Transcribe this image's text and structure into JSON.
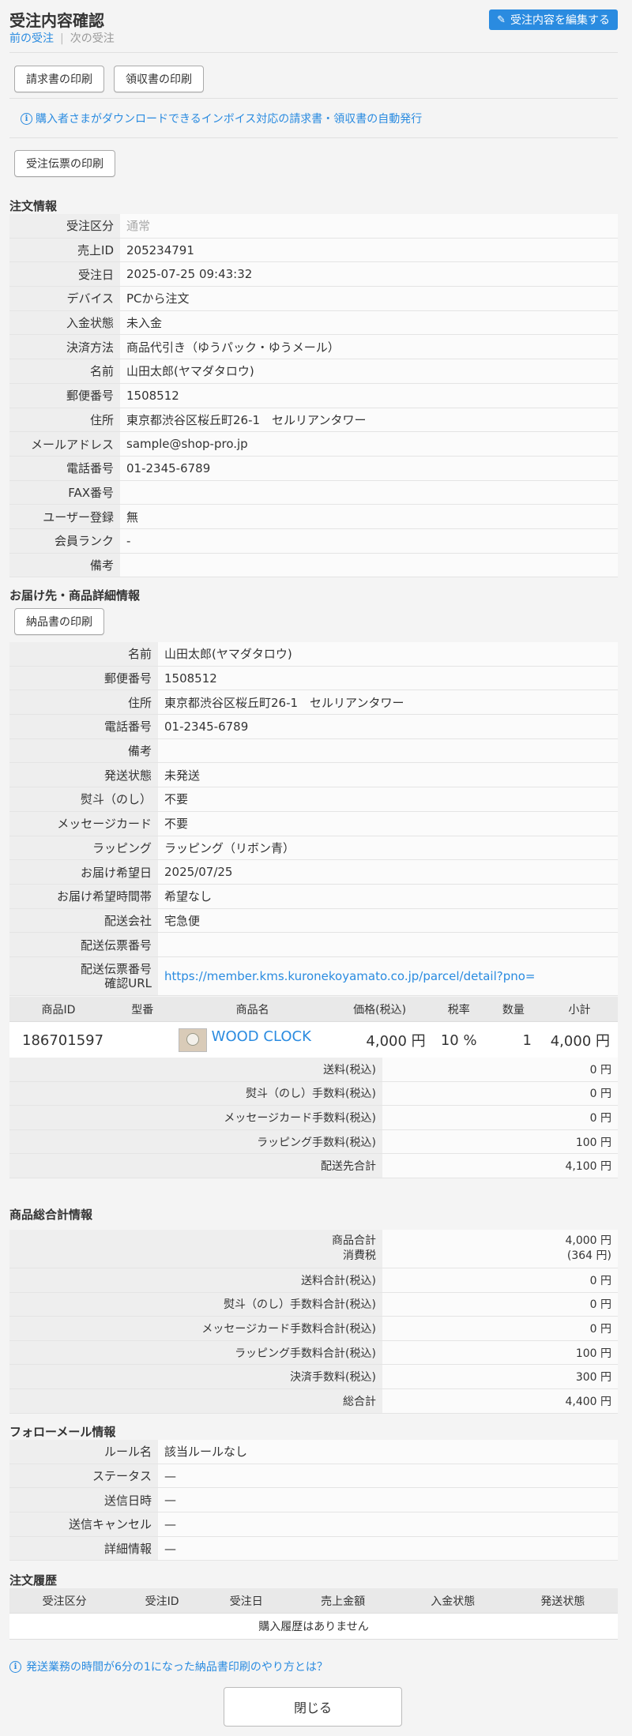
{
  "header": {
    "title": "受注内容確認",
    "edit_label": "受注内容を編集する",
    "prev_label": "前の受注",
    "next_label": "次の受注"
  },
  "print": {
    "invoice_label": "請求書の印刷",
    "receipt_label": "領収書の印刷",
    "invoice_info": "購入者さまがダウンロードできるインボイス対応の請求書・領収書の自動発行",
    "order_slip_label": "受注伝票の印刷",
    "delivery_note_label": "納品書の印刷"
  },
  "order_info": {
    "title": "注文情報",
    "rows": [
      {
        "k": "受注区分",
        "v": "通常"
      },
      {
        "k": "売上ID",
        "v": "205234791"
      },
      {
        "k": "受注日",
        "v": "2025-07-25 09:43:32"
      },
      {
        "k": "デバイス",
        "v": "PCから注文"
      },
      {
        "k": "入金状態",
        "v": "未入金"
      },
      {
        "k": "決済方法",
        "v": "商品代引き（ゆうパック・ゆうメール）"
      },
      {
        "k": "名前",
        "v": "山田太郎(ヤマダタロウ)"
      },
      {
        "k": "郵便番号",
        "v": "1508512"
      },
      {
        "k": "住所",
        "v": "東京都渋谷区桜丘町26-1　セルリアンタワー"
      },
      {
        "k": "メールアドレス",
        "v": "sample@shop-pro.jp"
      },
      {
        "k": "電話番号",
        "v": "01-2345-6789"
      },
      {
        "k": "FAX番号",
        "v": ""
      },
      {
        "k": "ユーザー登録",
        "v": "無"
      },
      {
        "k": "会員ランク",
        "v": "-"
      },
      {
        "k": "備考",
        "v": ""
      }
    ]
  },
  "delivery": {
    "title": "お届け先・商品詳細情報",
    "rows": [
      {
        "k": "名前",
        "v": "山田太郎(ヤマダタロウ)"
      },
      {
        "k": "郵便番号",
        "v": "1508512"
      },
      {
        "k": "住所",
        "v": "東京都渋谷区桜丘町26-1　セルリアンタワー"
      },
      {
        "k": "電話番号",
        "v": "01-2345-6789"
      },
      {
        "k": "備考",
        "v": ""
      },
      {
        "k": "発送状態",
        "v": "未発送"
      },
      {
        "k": "熨斗（のし）",
        "v": "不要"
      },
      {
        "k": "メッセージカード",
        "v": "不要"
      },
      {
        "k": "ラッピング",
        "v": "ラッピング（リボン青）"
      },
      {
        "k": "お届け希望日",
        "v": "2025/07/25"
      },
      {
        "k": "お届け希望時間帯",
        "v": "希望なし"
      },
      {
        "k": "配送会社",
        "v": "宅急便"
      },
      {
        "k": "配送伝票番号",
        "v": ""
      }
    ],
    "tracking_label_1": "配送伝票番号",
    "tracking_label_2": "確認URL",
    "tracking_url": "https://member.kms.kuronekoyamato.co.jp/parcel/detail?pno="
  },
  "products": {
    "headers": [
      "商品ID",
      "型番",
      "商品名",
      "価格(税込)",
      "税率",
      "数量",
      "小計"
    ],
    "rows": [
      {
        "id": "186701597",
        "model": "",
        "name": "WOOD CLOCK",
        "price": "4,000 円",
        "tax": "10 %",
        "qty": "1",
        "subtotal": "4,000 円"
      }
    ]
  },
  "delivery_totals": [
    {
      "k": "送料(税込)",
      "v": "0 円"
    },
    {
      "k": "熨斗（のし）手数料(税込)",
      "v": "0 円"
    },
    {
      "k": "メッセージカード手数料(税込)",
      "v": "0 円"
    },
    {
      "k": "ラッピング手数料(税込)",
      "v": "100 円"
    },
    {
      "k": "配送先合計",
      "v": "4,100 円"
    }
  ],
  "totals": {
    "title": "商品総合計情報",
    "goods_label": "商品合計",
    "tax_label": "消費税",
    "goods_value": "4,000 円",
    "tax_value": "(364 円)",
    "rows": [
      {
        "k": "送料合計(税込)",
        "v": "0 円"
      },
      {
        "k": "熨斗（のし）手数料合計(税込)",
        "v": "0 円"
      },
      {
        "k": "メッセージカード手数料合計(税込)",
        "v": "0 円"
      },
      {
        "k": "ラッピング手数料合計(税込)",
        "v": "100 円"
      },
      {
        "k": "決済手数料(税込)",
        "v": "300 円"
      },
      {
        "k": "総合計",
        "v": "4,400 円"
      }
    ]
  },
  "follow_mail": {
    "title": "フォローメール情報",
    "rows": [
      {
        "k": "ルール名",
        "v": "該当ルールなし"
      },
      {
        "k": "ステータス",
        "v": "—"
      },
      {
        "k": "送信日時",
        "v": "—"
      },
      {
        "k": "送信キャンセル",
        "v": "—"
      },
      {
        "k": "詳細情報",
        "v": "—"
      }
    ]
  },
  "history": {
    "title": "注文履歴",
    "headers": [
      "受注区分",
      "受注ID",
      "受注日",
      "売上金額",
      "入金状態",
      "発送状態"
    ],
    "empty": "購入履歴はありません"
  },
  "footer": {
    "help_link": "発送業務の時間が6分の1になった納品書印刷のやり方とは？",
    "close_label": "閉じる"
  }
}
